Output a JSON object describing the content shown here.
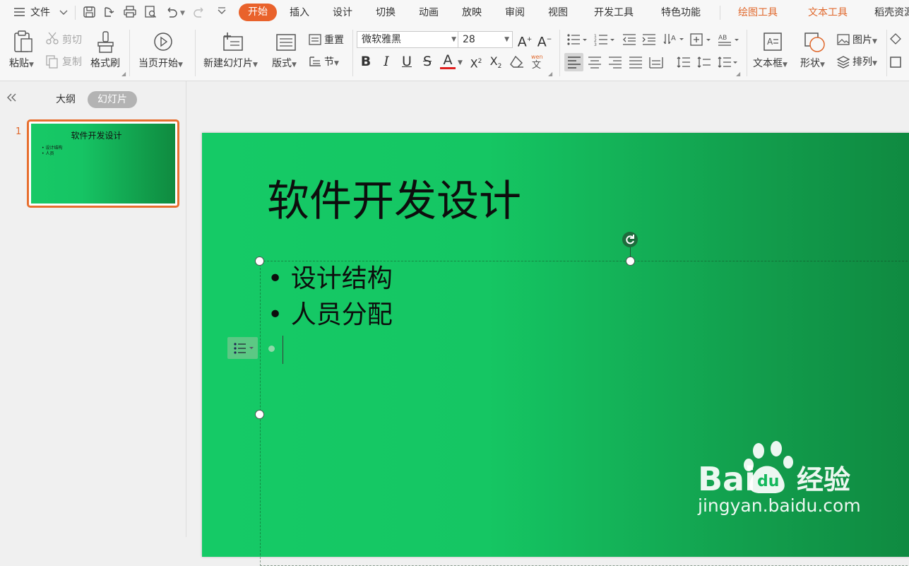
{
  "menu": {
    "file_label": "文件",
    "tabs": [
      "开始",
      "插入",
      "设计",
      "切换",
      "动画",
      "放映",
      "审阅",
      "视图",
      "开发工具",
      "特色功能"
    ],
    "context_tabs": [
      "绘图工具",
      "文本工具"
    ],
    "extra_tab": "稻壳资源",
    "accent_color": "#e9622b"
  },
  "ribbon": {
    "paste": "粘贴",
    "cut": "剪切",
    "copy": "复制",
    "format_painter": "格式刷",
    "play_current": "当页开始",
    "new_slide": "新建幻灯片",
    "layout": "版式",
    "reset": "重置",
    "section": "节",
    "font_name": "微软雅黑",
    "font_size": "28",
    "text_box": "文本框",
    "shape": "形状",
    "picture": "图片",
    "arrange": "排列"
  },
  "left_pane": {
    "outline_tab": "大纲",
    "slides_tab": "幻灯片",
    "slide_number": "1",
    "thumb_title": "软件开发设计",
    "thumb_bullets": [
      "设计结构",
      "人员"
    ]
  },
  "slide": {
    "title": "软件开发设计",
    "bullets": [
      "设计结构",
      "人员分配"
    ],
    "background_color": "#15ca66"
  },
  "watermark": {
    "logo_text": "Bai du 经验",
    "url": "jingyan.baidu.com"
  }
}
